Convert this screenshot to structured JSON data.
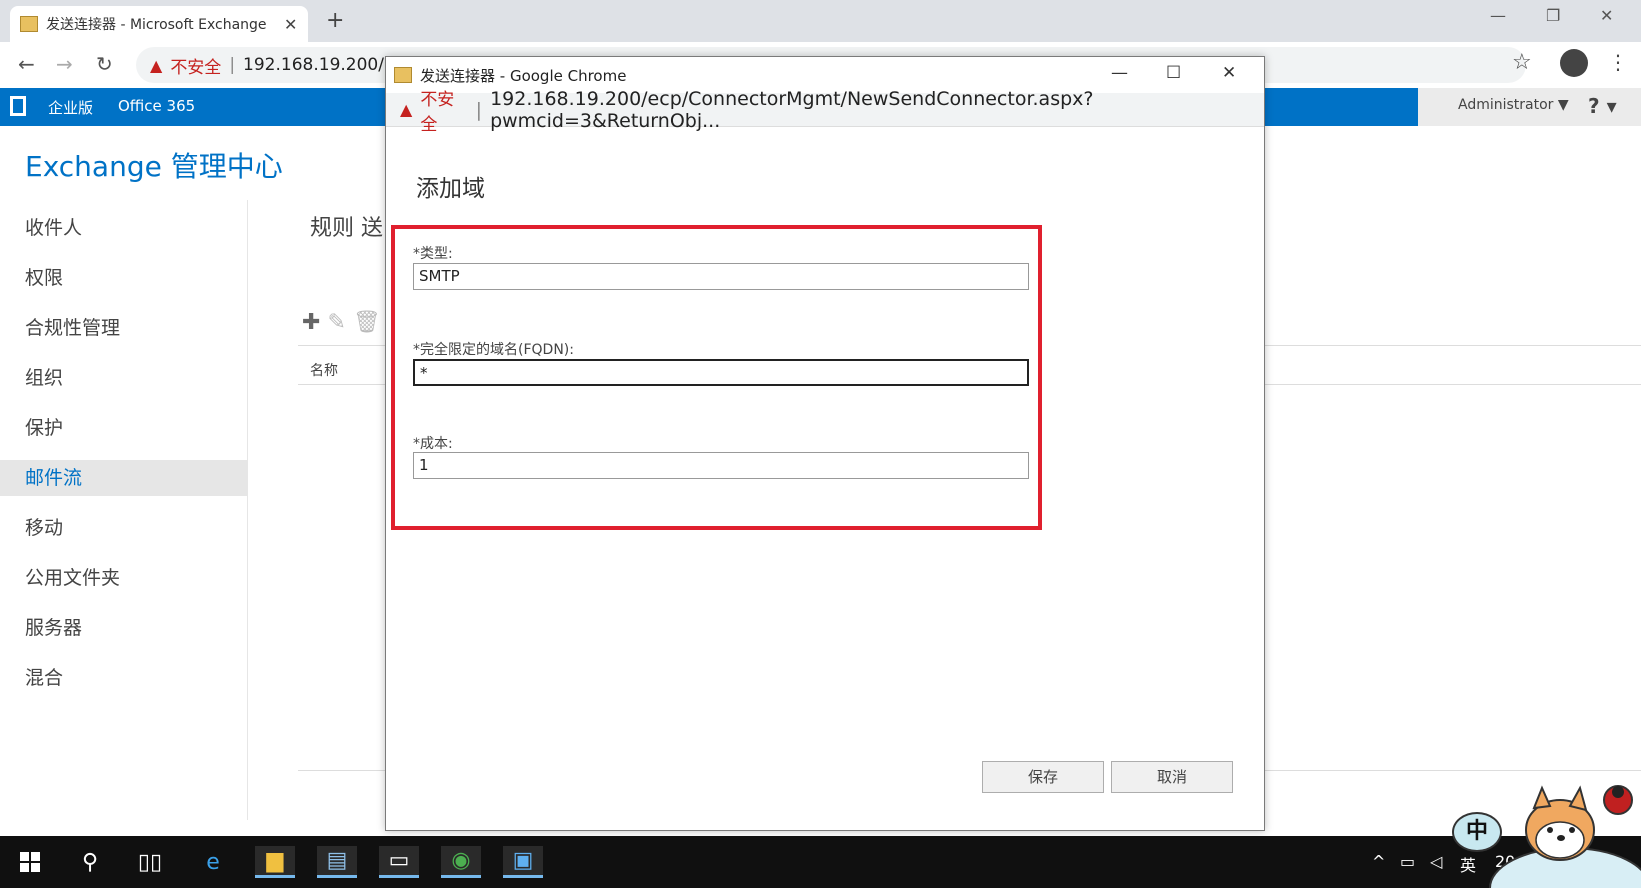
{
  "browser": {
    "tab_title": "发送连接器 - Microsoft Exchange",
    "new_tab_symbol": "+",
    "insecure_label": "不安全",
    "address_url": "192.168.19.200/",
    "separator": "|"
  },
  "office_bar": {
    "edition": "企业版",
    "office365": "Office 365",
    "user": "Administrator ▼",
    "help": "? ▾"
  },
  "eac": {
    "title": "Exchange 管理中心",
    "nav": [
      "收件人",
      "权限",
      "合规性管理",
      "组织",
      "保护",
      "邮件流",
      "移动",
      "公用文件夹",
      "服务器",
      "混合"
    ],
    "active_nav": "邮件流",
    "page_tab": "规则   送",
    "column_name": "名称"
  },
  "popup": {
    "window_title": "发送连接器 - Google Chrome",
    "insecure_label": "不安全",
    "url": "192.168.19.200/ecp/ConnectorMgmt/NewSendConnector.aspx?pwmcid=3&ReturnObj...",
    "heading": "添加域",
    "fields": {
      "type_label": "*类型:",
      "type_value": "SMTP",
      "fqdn_label": "*完全限定的域名(FQDN):",
      "fqdn_value": "*",
      "cost_label": "*成本:",
      "cost_value": "1"
    },
    "save_label": "保存",
    "cancel_label": "取消"
  },
  "taskbar": {
    "ime_mode": "中",
    "lang": "英",
    "clock_partial": "20"
  },
  "colors": {
    "accent": "#0072c6",
    "highlight_border": "#e0202e",
    "insecure": "#c5221f"
  }
}
